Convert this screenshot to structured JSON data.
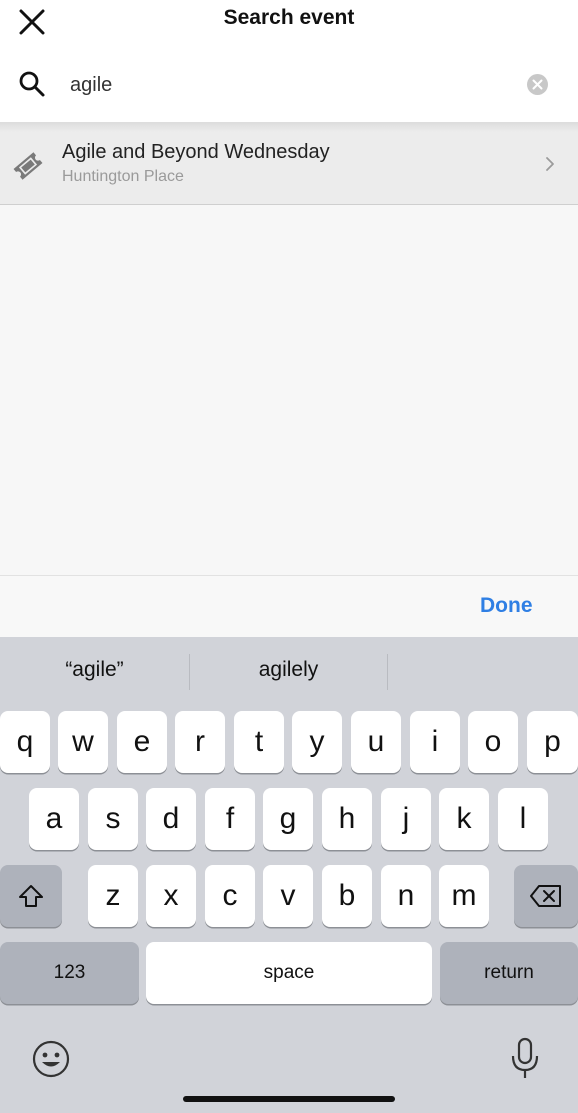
{
  "header": {
    "title": "Search event",
    "close_icon": "close-icon"
  },
  "search": {
    "value": "agile",
    "placeholder": "",
    "search_icon": "search-icon",
    "clear_icon": "clear-circle-icon"
  },
  "results": [
    {
      "name": "Agile and Beyond Wednesday",
      "venue": "Huntington Place",
      "icon": "ticket-icon"
    }
  ],
  "accessory": {
    "done_label": "Done"
  },
  "keyboard": {
    "suggestions": [
      "“agile”",
      "agilely",
      ""
    ],
    "row1": [
      "q",
      "w",
      "e",
      "r",
      "t",
      "y",
      "u",
      "i",
      "o",
      "p"
    ],
    "row2": [
      "a",
      "s",
      "d",
      "f",
      "g",
      "h",
      "j",
      "k",
      "l"
    ],
    "row3": [
      "z",
      "x",
      "c",
      "v",
      "b",
      "n",
      "m"
    ],
    "numbers_label": "123",
    "space_label": "space",
    "return_label": "return"
  },
  "colors": {
    "accent": "#2f7fe4",
    "keyboard_bg": "#d1d3d9",
    "row_bg": "#ececec"
  }
}
